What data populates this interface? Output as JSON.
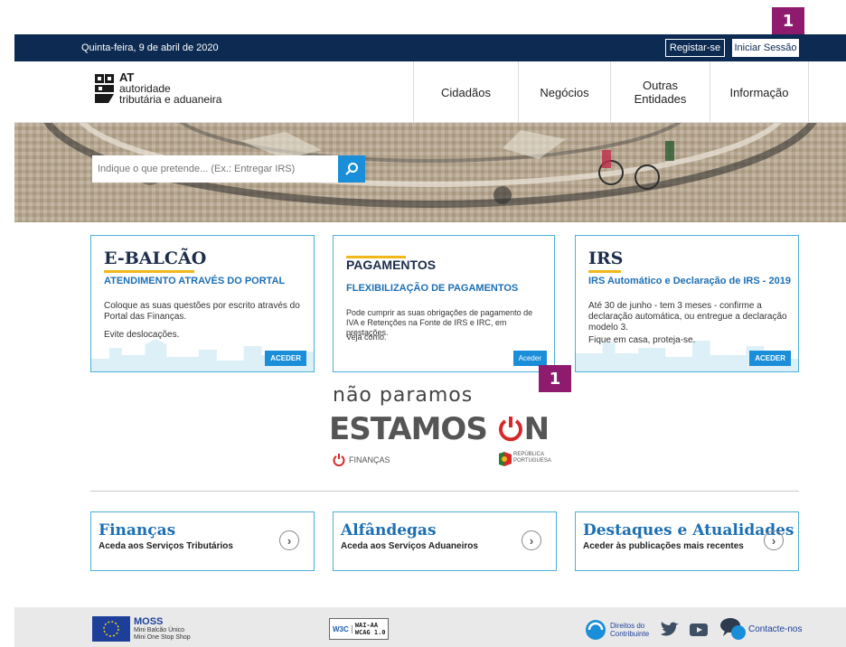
{
  "markers": {
    "top": "1",
    "payments": "1"
  },
  "topbar": {
    "date": "Quinta-feira, 9 de abril de 2020",
    "register": "Registar-se",
    "login": "Iniciar Sessão"
  },
  "logo": {
    "abbr": "AT",
    "line1": "autoridade",
    "line2": "tributária e aduaneira"
  },
  "nav": {
    "items": [
      "Cidadãos",
      "Negócios",
      "Outras Entidades",
      "Informação"
    ]
  },
  "search": {
    "placeholder": "Indique o que pretende... (Ex.: Entregar IRS)"
  },
  "cards": [
    {
      "title": "E-BALCÃO",
      "subtitle": "ATENDIMENTO ATRAVÉS DO PORTAL",
      "text1": "Coloque as suas questões por escrito através do Portal das Finanças.",
      "text2": "Evite deslocações.",
      "button": "ACEDER"
    },
    {
      "title": "PAGAMENTOS",
      "subtitle": "FLEXIBILIZAÇÃO DE PAGAMENTOS",
      "text1": "Pode cumprir as suas obrigações de pagamento de IVA e Retenções na Fonte de IRS e IRC, em prestações.",
      "text2": "Veja como.",
      "button": "Aceder"
    },
    {
      "title": "IRS",
      "subtitle": "IRS Automático e Declaração de IRS - 2019",
      "text1": "Até 30 de junho - tem 3 meses - confirme a declaração automática, ou entregue a declaração modelo 3.",
      "text2": "Fique em casa, proteja-se.",
      "button": "ACEDER"
    }
  ],
  "campaign": {
    "line1": "não paramos",
    "line2a": "ESTAMOS ",
    "line2b": "N",
    "financas": "FINANÇAS",
    "republica1": "REPÚBLICA",
    "republica2": "PORTUGUESA"
  },
  "links": [
    {
      "title": "Finanças",
      "subtitle": "Aceda aos Serviços Tributários"
    },
    {
      "title": "Alfândegas",
      "subtitle": "Aceda aos Serviços Aduaneiros"
    },
    {
      "title": "Destaques e Atualidades",
      "subtitle": "Aceder às publicações mais recentes"
    }
  ],
  "footer": {
    "moss_title": "MOSS",
    "moss_line1": "Mini Balcão Único",
    "moss_line2": "Mini One Stop Shop",
    "wai_line1": "WAI-AA",
    "wai_line2": "WCAG 1.0",
    "rights_line1": "Direitos do",
    "rights_line2": "Contribuinte",
    "contact": "Contacte-nos"
  },
  "colors": {
    "topbar": "#0d2b52",
    "accent_blue": "#1a8ed9",
    "card_border": "#4bb0d8",
    "title_underline": "#f2b71a",
    "marker": "#8e1b6e"
  }
}
